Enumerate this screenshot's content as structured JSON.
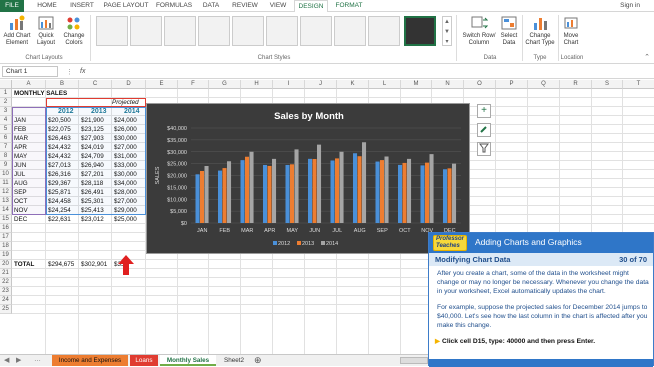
{
  "ribbon_tabs": [
    "FILE",
    "HOME",
    "INSERT",
    "PAGE LAYOUT",
    "FORMULAS",
    "DATA",
    "REVIEW",
    "VIEW",
    "DESIGN",
    "FORMAT"
  ],
  "signin": "Sign in",
  "ribbon": {
    "add_chart_element": "Add Chart Element",
    "quick_layout": "Quick Layout",
    "change_colors": "Change Colors",
    "group_chart_layouts": "Chart Layouts",
    "group_chart_styles": "Chart Styles",
    "switch_row_col": "Switch Row/ Column",
    "select_data": "Select Data",
    "group_data": "Data",
    "change_chart_type": "Change Chart Type",
    "group_type": "Type",
    "move_chart": "Move Chart",
    "group_location": "Location"
  },
  "formula_bar": {
    "name_box": "Chart 1",
    "fx": "fx",
    "value": ""
  },
  "columns": [
    "A",
    "B",
    "C",
    "D",
    "E",
    "F",
    "G",
    "H",
    "I",
    "J",
    "K",
    "L",
    "M",
    "N",
    "O",
    "P",
    "Q",
    "R",
    "S",
    "T"
  ],
  "rows": [
    "1",
    "2",
    "3",
    "4",
    "5",
    "6",
    "7",
    "8",
    "9",
    "10",
    "11",
    "12",
    "13",
    "14",
    "15",
    "16",
    "17",
    "18",
    "19",
    "20",
    "21",
    "22",
    "23",
    "24",
    "25"
  ],
  "sheet": {
    "title": "MONTHLY SALES",
    "projected": "Projected",
    "years": [
      "2012",
      "2013",
      "2014"
    ],
    "months": [
      "JAN",
      "FEB",
      "MAR",
      "APR",
      "MAY",
      "JUN",
      "JUL",
      "AUG",
      "SEP",
      "OCT",
      "NOV",
      "DEC"
    ],
    "y2012": [
      "$20,500",
      "$22,075",
      "$26,463",
      "$24,432",
      "$24,432",
      "$27,013",
      "$26,316",
      "$29,367",
      "$25,871",
      "$24,458",
      "$24,254",
      "$22,631"
    ],
    "y2013": [
      "$21,900",
      "$23,125",
      "$27,903",
      "$24,019",
      "$24,709",
      "$26,940",
      "$27,201",
      "$28,118",
      "$26,491",
      "$25,301",
      "$25,413",
      "$23,012"
    ],
    "y2014": [
      "$24,000",
      "$26,000",
      "$30,000",
      "$27,000",
      "$31,000",
      "$33,000",
      "$30,000",
      "$34,000",
      "$28,000",
      "$27,000",
      "$29,000",
      "$25,000"
    ],
    "total_label": "TOTAL",
    "totals": [
      "$294,675",
      "$302,901",
      "$35"
    ]
  },
  "chart_data": {
    "type": "bar",
    "title": "Sales by Month",
    "xlabel": "",
    "ylabel": "SALES",
    "categories": [
      "JAN",
      "FEB",
      "MAR",
      "APR",
      "MAY",
      "JUN",
      "JUL",
      "AUG",
      "SEP",
      "OCT",
      "NOV",
      "DEC"
    ],
    "ylim": [
      0,
      40000
    ],
    "yticks": [
      "$0",
      "$5,000",
      "$10,000",
      "$15,000",
      "$20,000",
      "$25,000",
      "$30,000",
      "$35,000",
      "$40,000"
    ],
    "legend_position": "bottom",
    "series": [
      {
        "name": "2012",
        "color": "#4a90d9",
        "values": [
          20500,
          22075,
          26463,
          24432,
          24432,
          27013,
          26316,
          29367,
          25871,
          24458,
          24254,
          22631
        ]
      },
      {
        "name": "2013",
        "color": "#ed7d31",
        "values": [
          21900,
          23125,
          27903,
          24019,
          24709,
          26940,
          27201,
          28118,
          26491,
          25301,
          25413,
          23012
        ]
      },
      {
        "name": "2014",
        "color": "#a5a5a5",
        "values": [
          24000,
          26000,
          30000,
          27000,
          31000,
          33000,
          30000,
          34000,
          28000,
          27000,
          29000,
          25000
        ]
      }
    ]
  },
  "sheet_tabs": [
    {
      "label": "Income and Expenses",
      "color": "#ed7d31"
    },
    {
      "label": "Loans",
      "color": "#e03c31"
    },
    {
      "label": "Monthly Sales",
      "color": "#70ad47"
    },
    {
      "label": "Sheet2",
      "color": ""
    }
  ],
  "tutor": {
    "title": "Adding Charts and Graphics",
    "logo": "Professor Teaches",
    "subtitle": "Modifying Chart Data",
    "counter": "30 of 70",
    "para1": "After you create a chart, some of the data in the worksheet might change or may no longer be necessary. Whenever you change the data in your worksheet, Excel automatically updates the chart.",
    "para2": "For example, suppose the projected sales for December 2014 jumps to $40,000. Let's see how the last column in the chart is affected after you make this change.",
    "instruction": "Click cell D15, type: 40000 and then press Enter."
  }
}
